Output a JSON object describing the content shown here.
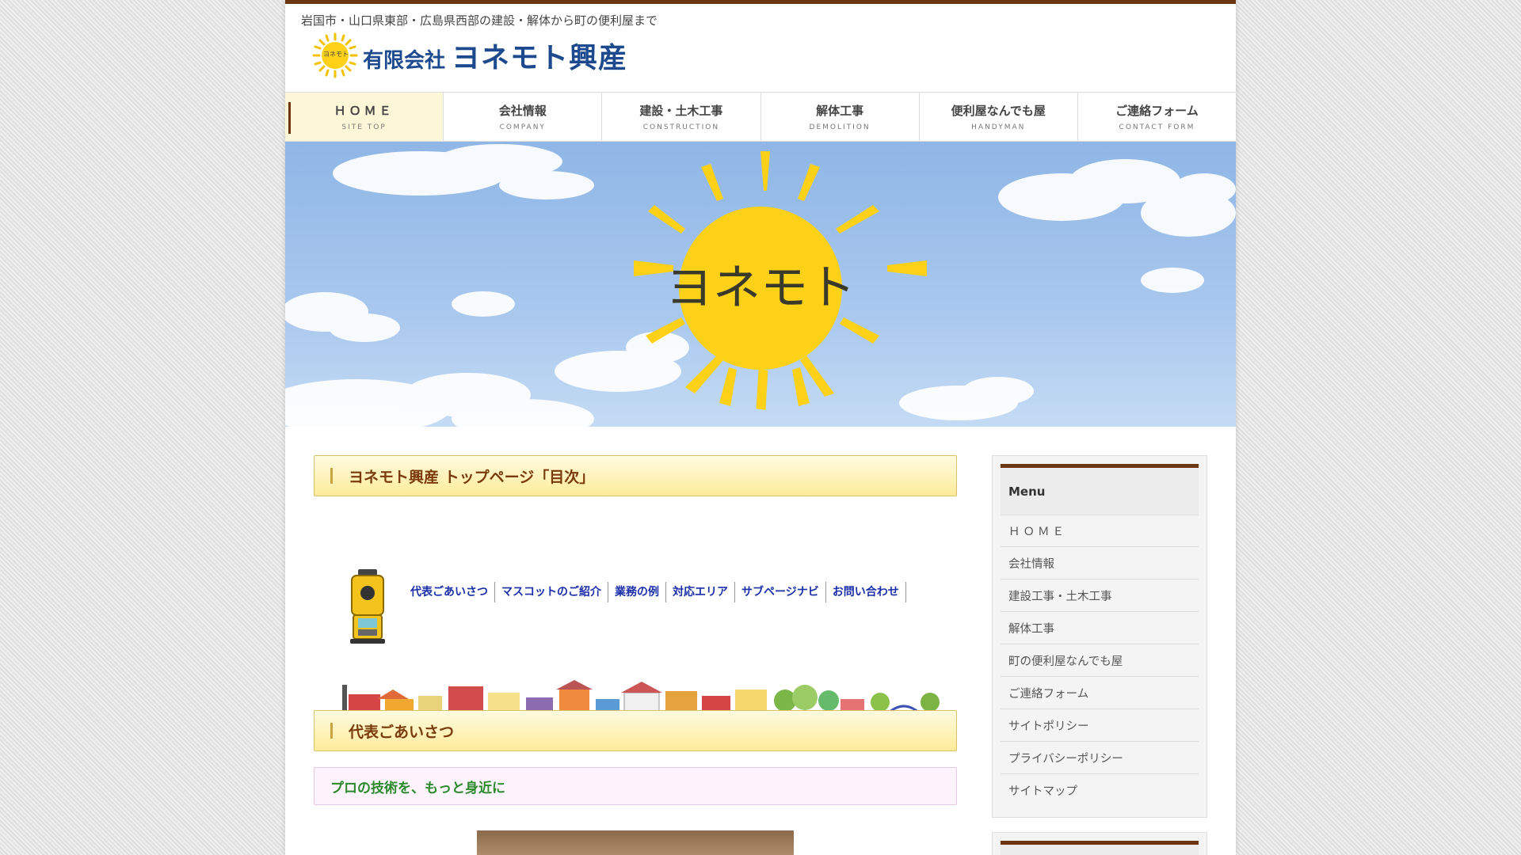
{
  "header": {
    "tagline": "岩国市・山口県東部・広島県西部の建設・解体から町の便利屋まで",
    "logo_prefix": "有限会社",
    "logo_name": "ヨネモト興産",
    "logo_icon_text": "ヨネモト"
  },
  "nav": {
    "items": [
      {
        "label": "ＨＯＭＥ",
        "sub": "SITE TOP"
      },
      {
        "label": "会社情報",
        "sub": "COMPANY"
      },
      {
        "label": "建設・土木工事",
        "sub": "CONSTRUCTION"
      },
      {
        "label": "解体工事",
        "sub": "DEMOLITION"
      },
      {
        "label": "便利屋なんでも屋",
        "sub": "HANDYMAN"
      },
      {
        "label": "ご連絡フォーム",
        "sub": "CONTACT FORM"
      }
    ]
  },
  "hero": {
    "sun_text": "ヨネモト"
  },
  "main": {
    "toc_heading": "ヨネモト興産 トップページ「目次」",
    "toc_links": [
      "代表ごあいさつ",
      "マスコットのご紹介",
      "業務の例",
      "対応エリア",
      "サブページナビ",
      "お問い合わせ"
    ],
    "greeting_heading": "代表ごあいさつ",
    "greeting_subheading": "プロの技術を、もっと身近に"
  },
  "sidebar": {
    "title": "Menu",
    "items": [
      "ＨＯＭＥ",
      "会社情報",
      "建設工事・土木工事",
      "解体工事",
      "町の便利屋なんでも屋",
      "ご連絡フォーム",
      "サイトポリシー",
      "プライバシーポリシー",
      "サイトマップ"
    ]
  },
  "colors": {
    "brand_brown": "#6b3510",
    "logo_blue": "#1d4a8f",
    "link_blue": "#1a2fa8",
    "sun_yellow": "#fcd117",
    "subheading_green": "#2b8a2b"
  }
}
